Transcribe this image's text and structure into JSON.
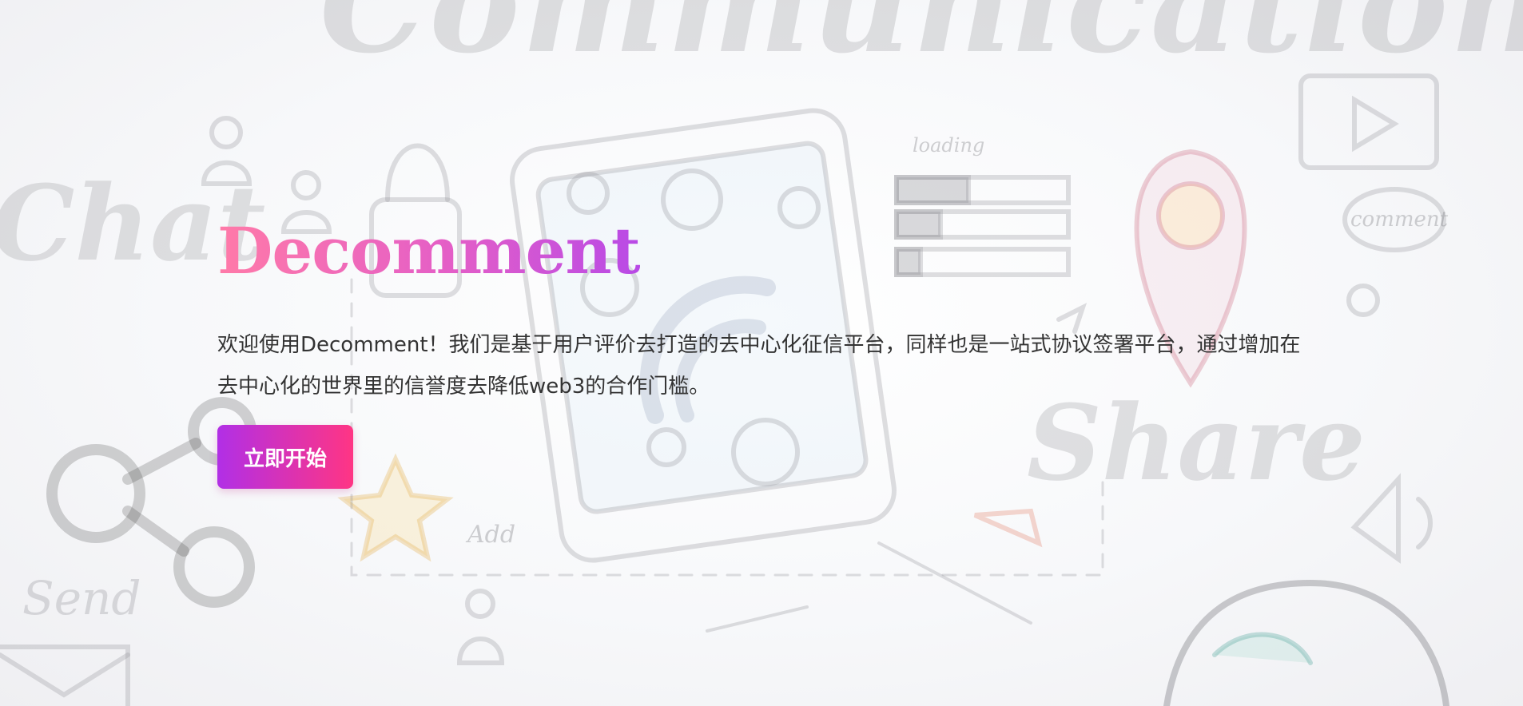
{
  "background": {
    "words": {
      "communication": "Communication",
      "chat": "Chat",
      "share": "Share",
      "send": "Send",
      "loading": "loading",
      "comment": "comment",
      "add": "Add"
    }
  },
  "hero": {
    "title": "Decomment",
    "description": "欢迎使用Decomment！我们是基于用户评价去打造的去中心化征信平台，同样也是一站式协议签署平台，通过增加在去中心化的世界里的信誉度去降低web3的合作门槛。",
    "cta_label": "立即开始"
  },
  "colors": {
    "title_gradient_start": "#ff7aa8",
    "title_gradient_end": "#b84ae6",
    "button_gradient_start": "#b12fe6",
    "button_gradient_end": "#ff3584",
    "text": "#333333"
  }
}
